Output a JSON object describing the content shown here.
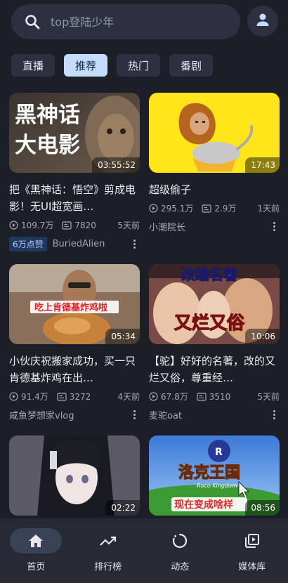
{
  "search": {
    "placeholder": "top登陆少年"
  },
  "tabs": [
    {
      "label": "直播",
      "active": false
    },
    {
      "label": "推荐",
      "active": true
    },
    {
      "label": "热门",
      "active": false
    },
    {
      "label": "番剧",
      "active": false
    }
  ],
  "videos": [
    {
      "thumb_text": "黑神话\n大电影",
      "duration": "03:55:52",
      "title": "把《黑神话：悟空》剪成电影！无UI超宽画…",
      "views": "109.7万",
      "comments": "7820",
      "time": "5天前",
      "badge": "6万点赞",
      "author": "BuriedAlien"
    },
    {
      "duration": "17:43",
      "title": "超级偷子",
      "views": "295.1万",
      "comments": "2.9万",
      "time": "1天前",
      "author": "小潮院长"
    },
    {
      "thumb_text": "吃上肯德基炸鸡啦",
      "duration": "05:34",
      "title": "小伙庆祝搬家成功，买一只肯德基炸鸡在出…",
      "views": "91.4万",
      "comments": "3272",
      "time": "4天前",
      "author": "咸鱼梦想家vlog"
    },
    {
      "thumb_text_top": "改编名著",
      "thumb_text_bottom": "又烂又俗",
      "duration": "10:06",
      "title": "【驼】好好的名著，改的又烂又俗，尊重经…",
      "views": "67.8万",
      "comments": "3510",
      "time": "5天前",
      "author": "麦驼oat"
    },
    {
      "duration": "02:22"
    },
    {
      "thumb_text_top": "洛克王国",
      "thumb_text_small": "Roco Kingdom",
      "thumb_text_bottom": "现在变成啥样",
      "duration": "08:56"
    }
  ],
  "nav": [
    {
      "label": "首页",
      "icon": "home-icon",
      "active": true
    },
    {
      "label": "排行榜",
      "icon": "trending-icon",
      "active": false
    },
    {
      "label": "动态",
      "icon": "activity-icon",
      "active": false
    },
    {
      "label": "媒体库",
      "icon": "media-library-icon",
      "active": false
    }
  ],
  "colors": {
    "background": "#1c1f27",
    "surface": "#2c3040",
    "tab_active": "#c5dcff",
    "badge_bg": "#21385e",
    "badge_text": "#a9c8ff"
  }
}
